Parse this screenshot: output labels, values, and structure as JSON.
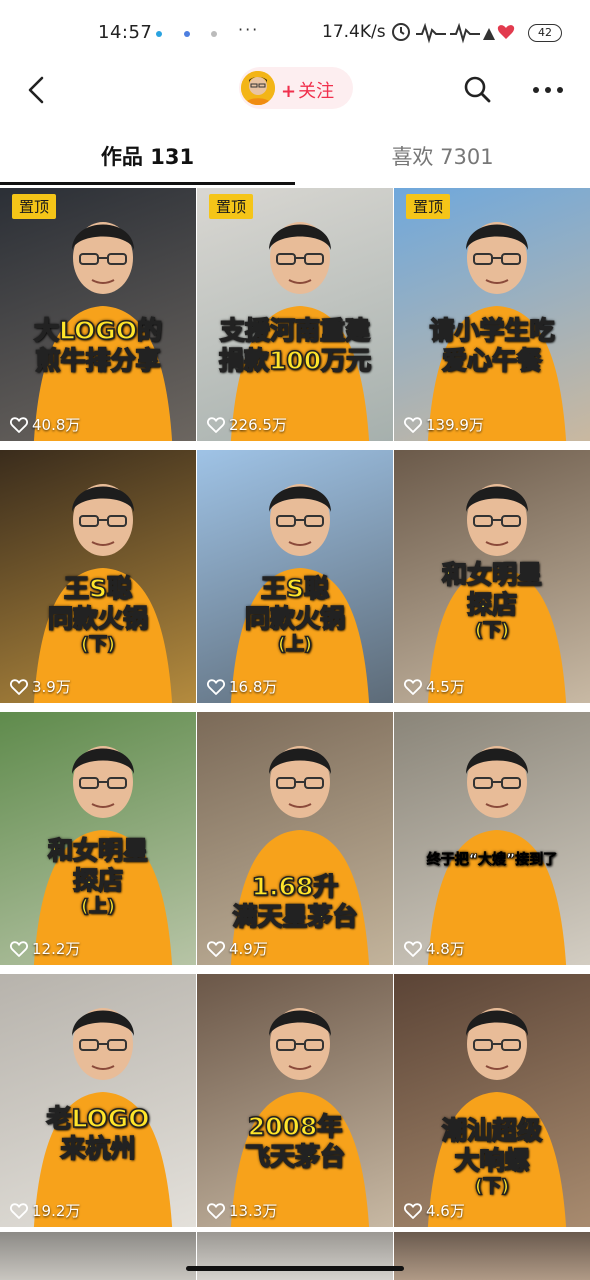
{
  "status_bar": {
    "time": "14:57",
    "network_speed": "17.4K/s",
    "battery": "42",
    "more": "···"
  },
  "nav": {
    "back_icon": "chevron-left-icon",
    "follow_label": "关注",
    "follow_plus": "+",
    "search_icon": "search-icon",
    "more_icon": "more-horizontal-icon",
    "accent_color": "#f0304d"
  },
  "tabs": [
    {
      "label": "作品 131",
      "active": true
    },
    {
      "label": "喜欢 7301",
      "active": false
    }
  ],
  "pinned_label": "置顶",
  "videos": [
    {
      "pinned": true,
      "caption": [
        "大LOGO的",
        "煎牛排分享"
      ],
      "likes": "40.8万",
      "bg": "#2b2f36",
      "bg2": "#6c6660"
    },
    {
      "pinned": true,
      "caption": [
        "支援河南重建",
        "捐款100万元"
      ],
      "likes": "226.5万",
      "bg": "#d9d7d2",
      "bg2": "#a6b0ad"
    },
    {
      "pinned": true,
      "caption": [
        "请小学生吃",
        "爱心午餐"
      ],
      "likes": "139.9万",
      "bg": "#6fa8dc",
      "bg2": "#c9b8a0"
    },
    {
      "pinned": false,
      "caption": [
        "王S聪",
        "同款火锅",
        "(下)"
      ],
      "likes": "3.9万",
      "bg": "#3a2c1c",
      "bg2": "#b48b3e"
    },
    {
      "pinned": false,
      "caption": [
        "王S聪",
        "同款火锅",
        "(上)"
      ],
      "likes": "16.8万",
      "bg": "#9fc3e6",
      "bg2": "#5d6b78"
    },
    {
      "pinned": false,
      "caption": [
        "和女明星",
        "探店",
        "(下)"
      ],
      "likes": "4.5万",
      "bg": "#6b5a4a",
      "bg2": "#c8b9a4"
    },
    {
      "pinned": false,
      "caption": [
        "和女明星",
        "探店",
        "(上)"
      ],
      "likes": "12.2万",
      "bg": "#5f8b4c",
      "bg2": "#b7c4a6"
    },
    {
      "pinned": false,
      "caption": [
        "1.68升",
        "满天星茅台"
      ],
      "likes": "4.9万",
      "bg": "#7b6a58",
      "bg2": "#c2b39b"
    },
    {
      "pinned": false,
      "caption": [
        "终于把“大嫂”接到了"
      ],
      "likes": "4.8万",
      "bg": "#8a8579",
      "bg2": "#d3cdc2"
    },
    {
      "pinned": false,
      "caption": [
        "老LOGO",
        "来杭州"
      ],
      "likes": "19.2万",
      "bg": "#b7b3ac",
      "bg2": "#e3e0da"
    },
    {
      "pinned": false,
      "caption": [
        "2008年",
        "飞天茅台"
      ],
      "likes": "13.3万",
      "bg": "#6b5748",
      "bg2": "#c7b8a3"
    },
    {
      "pinned": false,
      "caption": [
        "潮汕超级",
        "大响螺",
        "(下)"
      ],
      "likes": "4.6万",
      "bg": "#5b4436",
      "bg2": "#a88b6f"
    }
  ],
  "heart_icon": "heart-outline-icon",
  "shirt_color": "#f7a21b"
}
